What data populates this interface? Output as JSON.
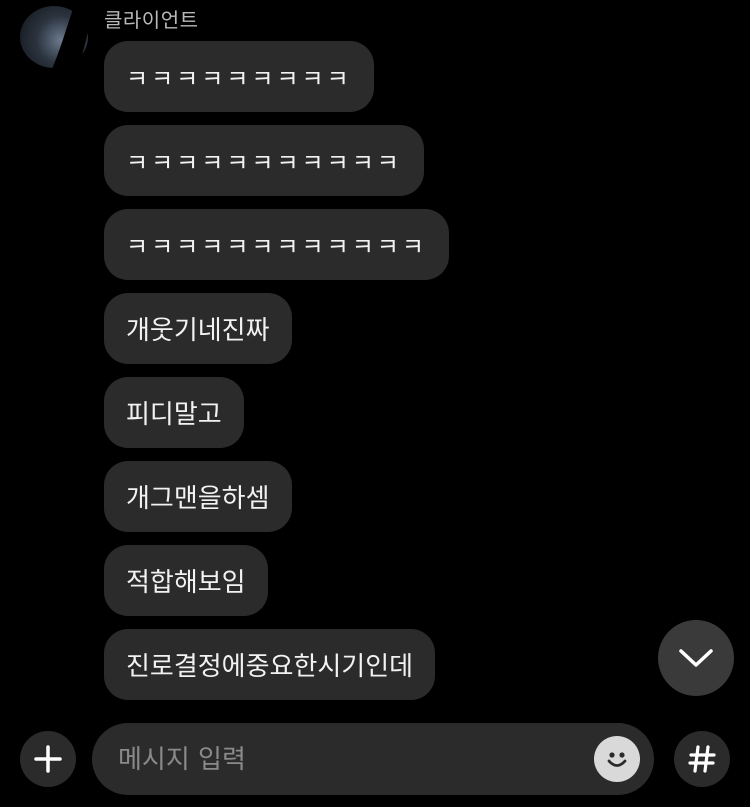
{
  "sender": {
    "name": "클라이언트"
  },
  "messages": [
    {
      "text": "ㅋㅋㅋㅋㅋㅋㅋㅋㅋ"
    },
    {
      "text": "ㅋㅋㅋㅋㅋㅋㅋㅋㅋㅋㅋ"
    },
    {
      "text": "ㅋㅋㅋㅋㅋㅋㅋㅋㅋㅋㅋㅋ"
    },
    {
      "text": "개웃기네진짜"
    },
    {
      "text": "피디말고"
    },
    {
      "text": "개그맨을하셈"
    },
    {
      "text": "적합해보임"
    },
    {
      "text": "진로결정에중요한시기인데"
    }
  ],
  "composer": {
    "placeholder": "메시지 입력",
    "value": ""
  },
  "icons": {
    "add": "plus-icon",
    "emoji": "smiley-icon",
    "hashtag": "hash-icon",
    "scroll": "chevron-down-icon"
  },
  "colors": {
    "background": "#000000",
    "bubble": "#2b2b2b",
    "text": "#f2f2f2",
    "placeholder": "#8a8a8a"
  }
}
